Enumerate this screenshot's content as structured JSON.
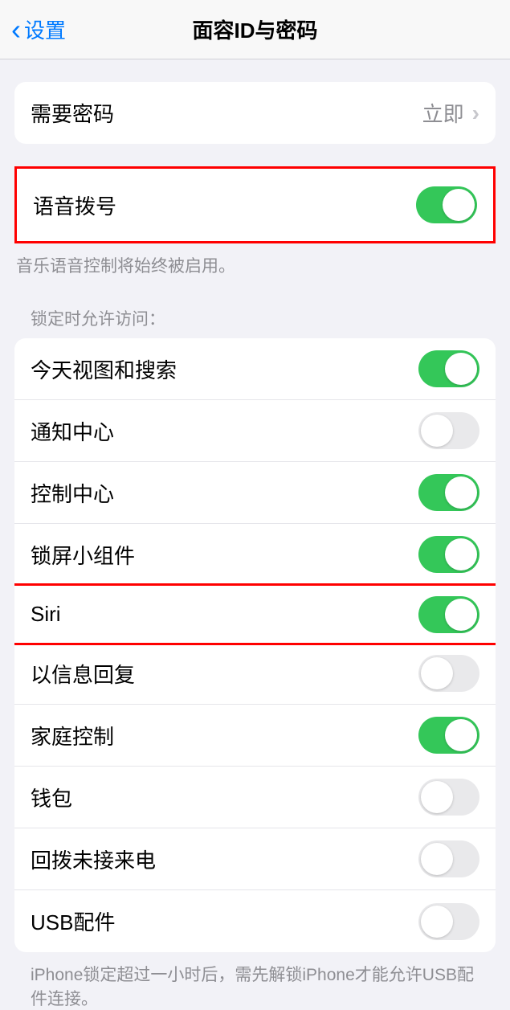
{
  "nav": {
    "back_label": "设置",
    "title": "面容ID与密码"
  },
  "section1": {
    "passcode_label": "需要密码",
    "passcode_value": "立即"
  },
  "section2": {
    "voice_dial_label": "语音拨号",
    "voice_dial_on": true,
    "footer": "音乐语音控制将始终被启用。"
  },
  "section3": {
    "header": "锁定时允许访问：",
    "items": [
      {
        "label": "今天视图和搜索",
        "on": true
      },
      {
        "label": "通知中心",
        "on": false
      },
      {
        "label": "控制中心",
        "on": true
      },
      {
        "label": "锁屏小组件",
        "on": true
      },
      {
        "label": "Siri",
        "on": true
      },
      {
        "label": "以信息回复",
        "on": false
      },
      {
        "label": "家庭控制",
        "on": true
      },
      {
        "label": "钱包",
        "on": false
      },
      {
        "label": "回拨未接来电",
        "on": false
      },
      {
        "label": "USB配件",
        "on": false
      }
    ],
    "footer": "iPhone锁定超过一小时后，需先解锁iPhone才能允许USB配件连接。"
  },
  "highlights": {
    "voice_dial_highlighted": true,
    "siri_highlighted": true
  }
}
